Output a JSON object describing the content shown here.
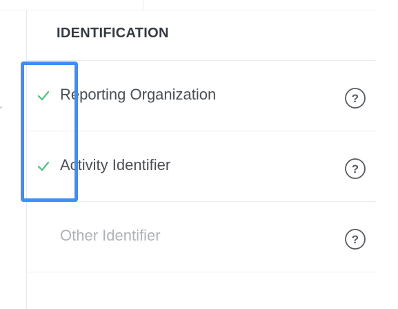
{
  "section": {
    "title": "IDENTIFICATION"
  },
  "fields": [
    {
      "label": "Reporting Organization",
      "completed": true,
      "help_icon": "question-circle-icon"
    },
    {
      "label": "Activity Identifier",
      "completed": true,
      "help_icon": "question-circle-icon"
    },
    {
      "label": "Other Identifier",
      "completed": false,
      "help_icon": "question-circle-icon"
    }
  ],
  "colors": {
    "check": "#5cc08a",
    "highlight": "#3d8ef7",
    "label": "#4a4f55",
    "label_disabled": "#aeb3b8"
  }
}
